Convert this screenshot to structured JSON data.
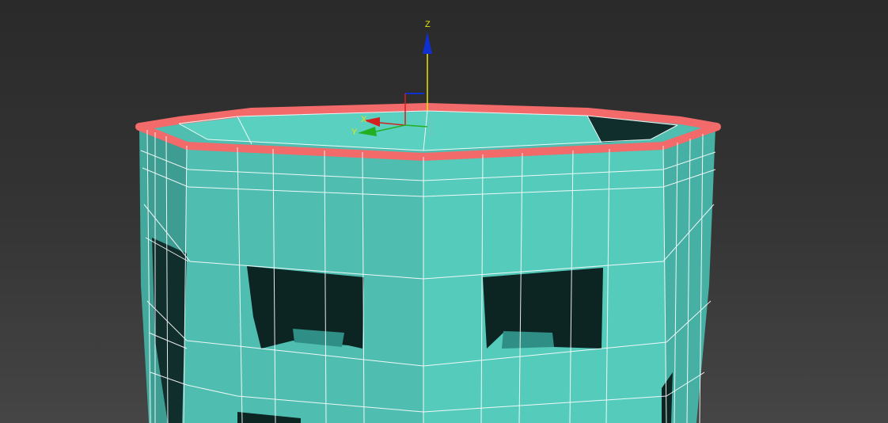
{
  "viewport": {
    "gizmo": {
      "z_label": "Z",
      "x_label": "X",
      "y_label": "Y"
    },
    "colors": {
      "background_top": "#2a2a2a",
      "background_bottom": "#454545",
      "mesh_front": "#53c7b8",
      "mesh_side": "#46aea2",
      "mesh_dark": "#0c2a28",
      "selection": "#f26a6a",
      "wire": "#ffffff",
      "axis_x": "#d42020",
      "axis_y": "#22b022",
      "axis_z": "#1030d0",
      "axis_label": "#e6e600"
    }
  }
}
